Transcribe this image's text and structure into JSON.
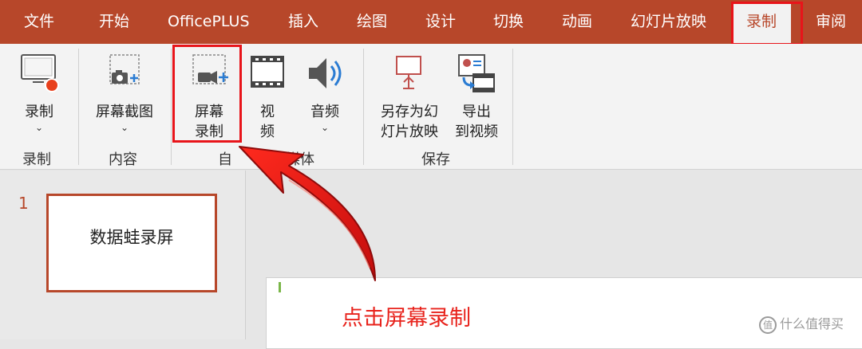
{
  "menu": {
    "tabs": [
      "文件",
      "开始",
      "OfficePLUS",
      "插入",
      "绘图",
      "设计",
      "切换",
      "动画",
      "幻灯片放映",
      "录制",
      "审阅"
    ],
    "active_tab": "录制"
  },
  "ribbon": {
    "record": {
      "label": "录制"
    },
    "screenshot": {
      "label": "屏幕截图"
    },
    "screen_record": {
      "label_line1": "屏幕",
      "label_line2": "录制"
    },
    "video": {
      "label_line1": "视",
      "label_line2": "频"
    },
    "audio": {
      "label": "音频"
    },
    "save_as_show": {
      "label_line1": "另存为幻",
      "label_line2": "灯片放映"
    },
    "export_video": {
      "label_line1": "导出",
      "label_line2": "到视频"
    },
    "groups": {
      "record": "录制",
      "content": "内容",
      "auto_media_visible": "自",
      "auto_media_tail": "动媒体",
      "save": "保存"
    }
  },
  "slides": {
    "number": "1",
    "thumb_text": "数据蛙录屏"
  },
  "annotation": "点击屏幕录制",
  "watermark": "值 什么值得买",
  "colors": {
    "accent": "#b7472a",
    "highlight_red": "#e8141a"
  }
}
